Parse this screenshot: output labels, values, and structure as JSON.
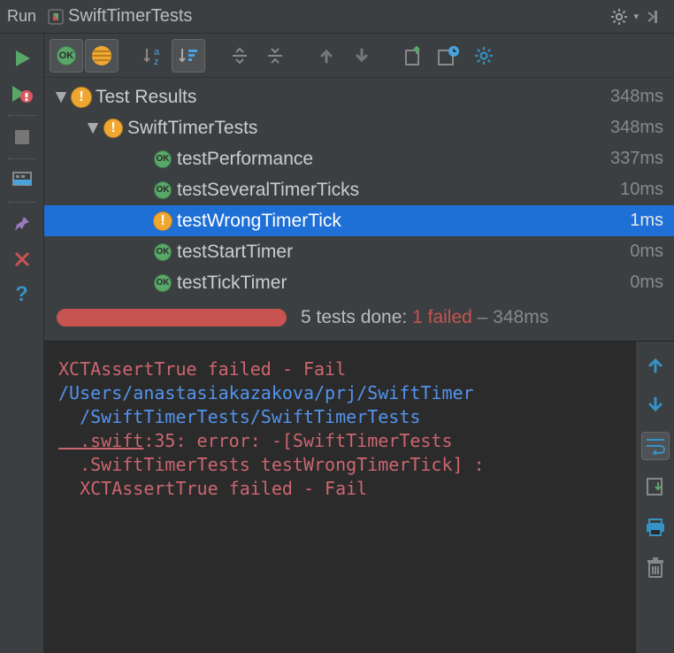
{
  "titlebar": {
    "label": "Run",
    "config": "SwiftTimerTests"
  },
  "colors": {
    "accent": "#1e6fd6",
    "fail": "#c75450",
    "ok": "#59a869",
    "path": "#5394ec"
  },
  "tree": {
    "root": {
      "name": "Test Results",
      "time": "348ms",
      "status": "warn"
    },
    "suite": {
      "name": "SwiftTimerTests",
      "time": "348ms",
      "status": "warn"
    },
    "tests": [
      {
        "name": "testPerformance",
        "time": "337ms",
        "status": "ok",
        "selected": false
      },
      {
        "name": "testSeveralTimerTicks",
        "time": "10ms",
        "status": "ok",
        "selected": false
      },
      {
        "name": "testWrongTimerTick",
        "time": "1ms",
        "status": "warn",
        "selected": true
      },
      {
        "name": "testStartTimer",
        "time": "0ms",
        "status": "ok",
        "selected": false
      },
      {
        "name": "testTickTimer",
        "time": "0ms",
        "status": "ok",
        "selected": false
      }
    ]
  },
  "summary": {
    "done_prefix": "5 tests done: ",
    "fail": "1 failed",
    "suffix": " – 348ms"
  },
  "console": {
    "l1": "XCTAssertTrue failed - Fail",
    "l2": "/Users/anastasiakazakova/prj/SwiftTimer",
    "l3_a": "  /SwiftTimerTests/SwiftTimerTests",
    "l3_link": "  .swift",
    "l3_b": ":35: error: -[SwiftTimerTests",
    "l4": "  .SwiftTimerTests testWrongTimerTick] : ",
    "l5": "  XCTAssertTrue failed - Fail"
  }
}
